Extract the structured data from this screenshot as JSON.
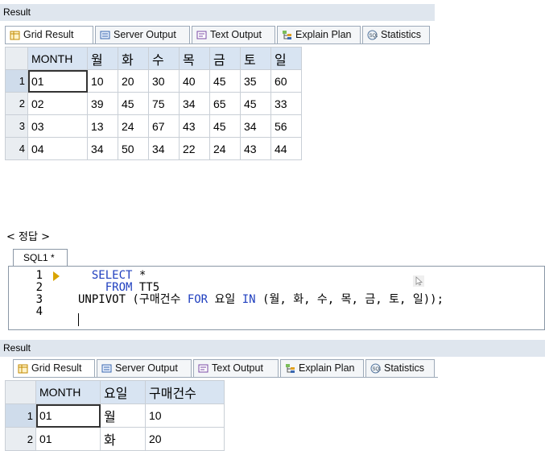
{
  "top_panel": {
    "title": "Result",
    "tabs": [
      "Grid Result",
      "Server Output",
      "Text Output",
      "Explain Plan",
      "Statistics"
    ],
    "grid": {
      "headers": [
        "MONTH",
        "월",
        "화",
        "수",
        "목",
        "금",
        "토",
        "일"
      ],
      "rows": [
        {
          "num": "1",
          "cells": [
            "01",
            "10",
            "20",
            "30",
            "40",
            "45",
            "35",
            "60"
          ]
        },
        {
          "num": "2",
          "cells": [
            "02",
            "39",
            "45",
            "75",
            "34",
            "65",
            "45",
            "33"
          ]
        },
        {
          "num": "3",
          "cells": [
            "03",
            "13",
            "24",
            "67",
            "43",
            "45",
            "34",
            "56"
          ]
        },
        {
          "num": "4",
          "cells": [
            "04",
            "34",
            "50",
            "34",
            "22",
            "24",
            "43",
            "44"
          ]
        }
      ]
    }
  },
  "answer_label": "< 정답 >",
  "editor": {
    "tab_label": "SQL1 *",
    "line_numbers": [
      "1",
      "2",
      "3",
      "4"
    ],
    "line1": {
      "indent": "  ",
      "kw": "SELECT",
      "rest": " *"
    },
    "line2": {
      "indent": "    ",
      "kw": "FROM",
      "rest": " TT5"
    },
    "line3": {
      "p1": "UNPIVOT (구매건수 ",
      "kw1": "FOR",
      "p2": " 요일 ",
      "kw2": "IN",
      "p3": " (월, 화, 수, 목, 금, 토, 일));"
    }
  },
  "bottom_panel": {
    "title": "Result",
    "tabs": [
      "Grid Result",
      "Server Output",
      "Text Output",
      "Explain Plan",
      "Statistics"
    ],
    "grid": {
      "headers": [
        "MONTH",
        "요일",
        "구매건수"
      ],
      "rows": [
        {
          "num": "1",
          "cells": [
            "01",
            "월",
            "10"
          ]
        },
        {
          "num": "2",
          "cells": [
            "01",
            "화",
            "20"
          ]
        }
      ]
    }
  }
}
